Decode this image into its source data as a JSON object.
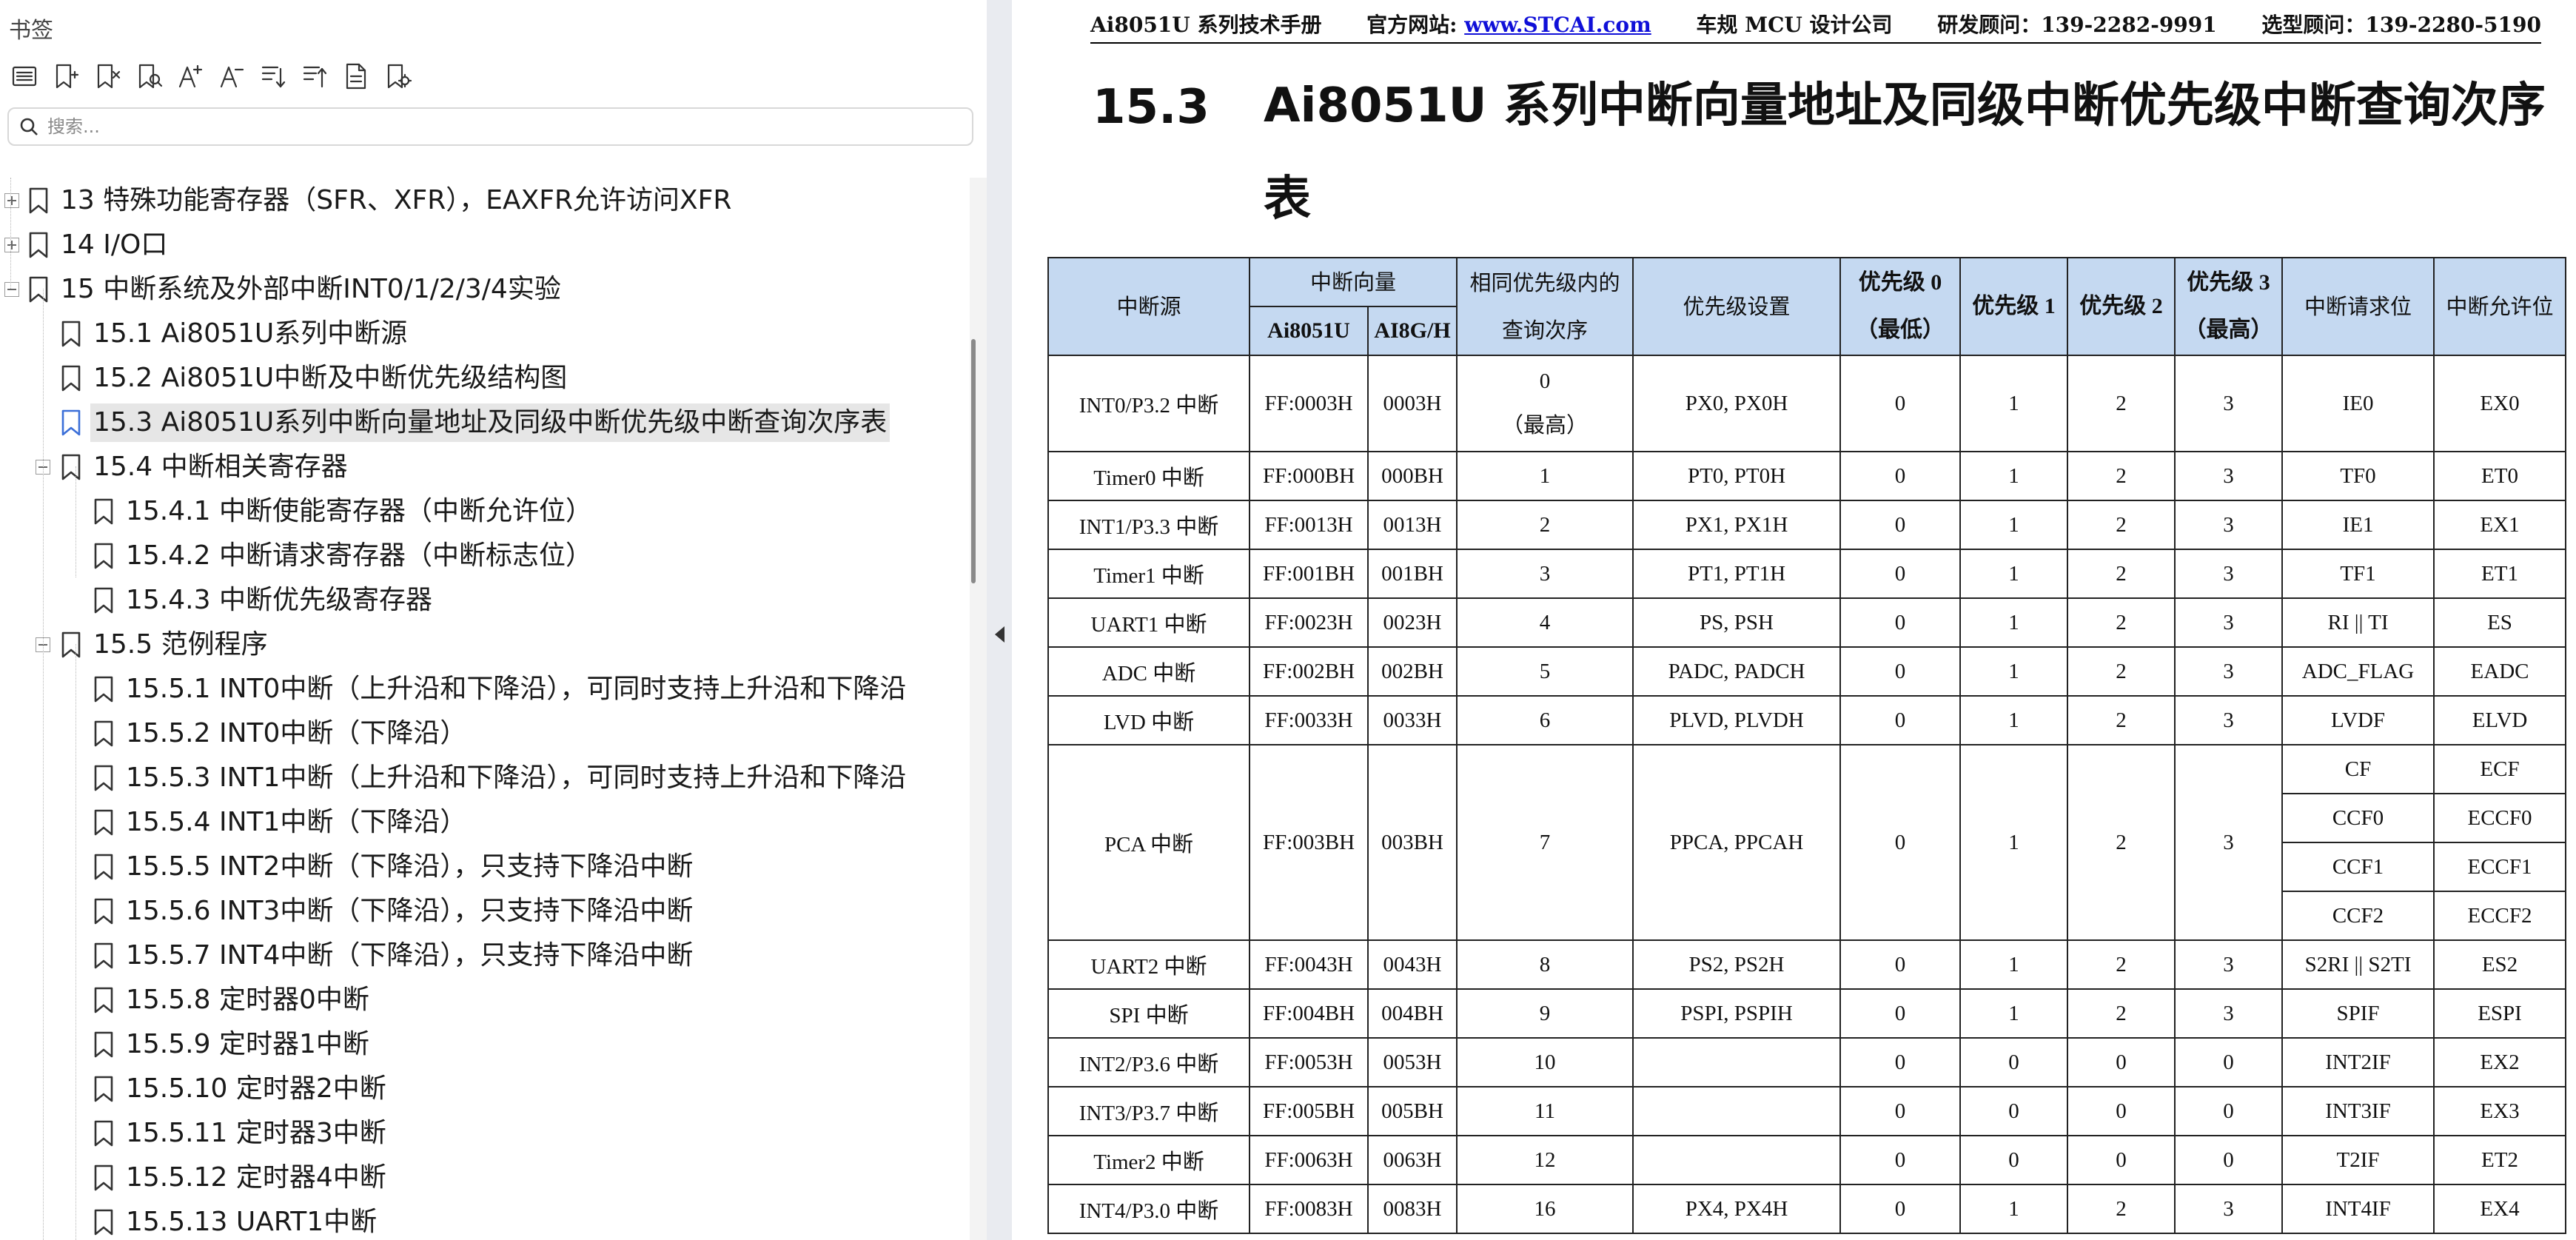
{
  "sidebar": {
    "title": "书签",
    "search_placeholder": "搜索...",
    "toolbar_icons": [
      "list-icon",
      "add-bookmark-icon",
      "delete-bookmark-icon",
      "find-bookmark-icon",
      "expand-text-icon",
      "shrink-text-icon",
      "expand-all-icon",
      "collapse-all-icon",
      "bookmark-properties-icon",
      "bookmark-settings-icon"
    ],
    "items": [
      {
        "label": "13  特殊功能寄存器（SFR、XFR），EAXFR允许访问XFR",
        "level": 0,
        "expander": "plus"
      },
      {
        "label": "14  I/O口",
        "level": 0,
        "expander": "plus"
      },
      {
        "label": "15  中断系统及外部中断INT0/1/2/3/4实验",
        "level": 0,
        "expander": "minus"
      },
      {
        "label": "15.1  Ai8051U系列中断源",
        "level": 1
      },
      {
        "label": "15.2  Ai8051U中断及中断优先级结构图",
        "level": 1
      },
      {
        "label": "15.3  Ai8051U系列中断向量地址及同级中断优先级中断查询次序表",
        "level": 1,
        "selected": true
      },
      {
        "label": "15.4  中断相关寄存器",
        "level": 1,
        "expander": "minus"
      },
      {
        "label": "15.4.1 中断使能寄存器（中断允许位）",
        "level": 2
      },
      {
        "label": "15.4.2  中断请求寄存器（中断标志位）",
        "level": 2
      },
      {
        "label": "15.4.3  中断优先级寄存器",
        "level": 2
      },
      {
        "label": "15.5  范例程序",
        "level": 1,
        "expander": "minus"
      },
      {
        "label": "15.5.1 INT0中断（上升沿和下降沿），可同时支持上升沿和下降沿",
        "level": 2
      },
      {
        "label": "15.5.2 INT0中断（下降沿）",
        "level": 2
      },
      {
        "label": "15.5.3 INT1中断（上升沿和下降沿），可同时支持上升沿和下降沿",
        "level": 2
      },
      {
        "label": "15.5.4 INT1中断（下降沿）",
        "level": 2
      },
      {
        "label": "15.5.5 INT2中断（下降沿），只支持下降沿中断",
        "level": 2
      },
      {
        "label": "15.5.6 INT3中断（下降沿），只支持下降沿中断",
        "level": 2
      },
      {
        "label": "15.5.7 INT4中断（下降沿），只支持下降沿中断",
        "level": 2
      },
      {
        "label": "15.5.8 定时器0中断",
        "level": 2
      },
      {
        "label": "15.5.9 定时器1中断",
        "level": 2
      },
      {
        "label": "15.5.10 定时器2中断",
        "level": 2
      },
      {
        "label": "15.5.11 定时器3中断",
        "level": 2
      },
      {
        "label": "15.5.12 定时器4中断",
        "level": 2
      },
      {
        "label": "15.5.13 UART1中断",
        "level": 2
      }
    ]
  },
  "doc": {
    "header": {
      "manual": "Ai8051U 系列技术手册",
      "website_label": "官方网站: ",
      "website_link": "www.STCAI.com",
      "company": "车规 MCU 设计公司",
      "rd_advisor": "研发顾问：139-2282-9991",
      "selection_advisor": "选型顾问：139-2280-5190"
    },
    "section_number": "15.3",
    "section_title": "Ai8051U  系列中断向量地址及同级中断优先级中断查询次序表",
    "table": {
      "headers": {
        "source": "中断源",
        "vector": "中断向量",
        "vec_a": "Ai8051U",
        "vec_b": "AI8G/H",
        "order": [
          "相同优先级内的",
          "查询次序"
        ],
        "priority_setting": "优先级设置",
        "p0": [
          "优先级 0",
          "（最低）"
        ],
        "p1": "优先级 1",
        "p2": "优先级 2",
        "p3": [
          "优先级 3",
          "（最高）"
        ],
        "request_bit": "中断请求位",
        "enable_bit": "中断允许位"
      },
      "rows": [
        {
          "source": "INT0/P3.2 中断",
          "vec_a": "FF:0003H",
          "vec_b": "0003H",
          "order": [
            "0",
            "（最高）"
          ],
          "priority": "PX0, PX0H",
          "p0": "0",
          "p1": "1",
          "p2": "2",
          "p3": "3",
          "req": [
            "IE0"
          ],
          "en": [
            "EX0"
          ]
        },
        {
          "source": "Timer0 中断",
          "vec_a": "FF:000BH",
          "vec_b": "000BH",
          "order": [
            "1"
          ],
          "priority": "PT0, PT0H",
          "p0": "0",
          "p1": "1",
          "p2": "2",
          "p3": "3",
          "req": [
            "TF0"
          ],
          "en": [
            "ET0"
          ]
        },
        {
          "source": "INT1/P3.3 中断",
          "vec_a": "FF:0013H",
          "vec_b": "0013H",
          "order": [
            "2"
          ],
          "priority": "PX1, PX1H",
          "p0": "0",
          "p1": "1",
          "p2": "2",
          "p3": "3",
          "req": [
            "IE1"
          ],
          "en": [
            "EX1"
          ]
        },
        {
          "source": "Timer1 中断",
          "vec_a": "FF:001BH",
          "vec_b": "001BH",
          "order": [
            "3"
          ],
          "priority": "PT1, PT1H",
          "p0": "0",
          "p1": "1",
          "p2": "2",
          "p3": "3",
          "req": [
            "TF1"
          ],
          "en": [
            "ET1"
          ]
        },
        {
          "source": "UART1 中断",
          "vec_a": "FF:0023H",
          "vec_b": "0023H",
          "order": [
            "4"
          ],
          "priority": "PS, PSH",
          "p0": "0",
          "p1": "1",
          "p2": "2",
          "p3": "3",
          "req": [
            "RI || TI"
          ],
          "en": [
            "ES"
          ]
        },
        {
          "source": "ADC 中断",
          "vec_a": "FF:002BH",
          "vec_b": "002BH",
          "order": [
            "5"
          ],
          "priority": "PADC, PADCH",
          "p0": "0",
          "p1": "1",
          "p2": "2",
          "p3": "3",
          "req": [
            "ADC_FLAG"
          ],
          "en": [
            "EADC"
          ]
        },
        {
          "source": "LVD 中断",
          "vec_a": "FF:0033H",
          "vec_b": "0033H",
          "order": [
            "6"
          ],
          "priority": "PLVD, PLVDH",
          "p0": "0",
          "p1": "1",
          "p2": "2",
          "p3": "3",
          "req": [
            "LVDF"
          ],
          "en": [
            "ELVD"
          ]
        },
        {
          "source": "PCA 中断",
          "vec_a": "FF:003BH",
          "vec_b": "003BH",
          "order": [
            "7"
          ],
          "priority": "PPCA, PPCAH",
          "p0": "0",
          "p1": "1",
          "p2": "2",
          "p3": "3",
          "req": [
            "CF",
            "CCF0",
            "CCF1",
            "CCF2"
          ],
          "en": [
            "ECF",
            "ECCF0",
            "ECCF1",
            "ECCF2"
          ]
        },
        {
          "source": "UART2 中断",
          "vec_a": "FF:0043H",
          "vec_b": "0043H",
          "order": [
            "8"
          ],
          "priority": "PS2, PS2H",
          "p0": "0",
          "p1": "1",
          "p2": "2",
          "p3": "3",
          "req": [
            "S2RI || S2TI"
          ],
          "en": [
            "ES2"
          ]
        },
        {
          "source": "SPI 中断",
          "vec_a": "FF:004BH",
          "vec_b": "004BH",
          "order": [
            "9"
          ],
          "priority": "PSPI, PSPIH",
          "p0": "0",
          "p1": "1",
          "p2": "2",
          "p3": "3",
          "req": [
            "SPIF"
          ],
          "en": [
            "ESPI"
          ]
        },
        {
          "source": "INT2/P3.6 中断",
          "vec_a": "FF:0053H",
          "vec_b": "0053H",
          "order": [
            "10"
          ],
          "priority": "",
          "p0": "0",
          "p1": "0",
          "p2": "0",
          "p3": "0",
          "req": [
            "INT2IF"
          ],
          "en": [
            "EX2"
          ]
        },
        {
          "source": "INT3/P3.7 中断",
          "vec_a": "FF:005BH",
          "vec_b": "005BH",
          "order": [
            "11"
          ],
          "priority": "",
          "p0": "0",
          "p1": "0",
          "p2": "0",
          "p3": "0",
          "req": [
            "INT3IF"
          ],
          "en": [
            "EX3"
          ]
        },
        {
          "source": "Timer2 中断",
          "vec_a": "FF:0063H",
          "vec_b": "0063H",
          "order": [
            "12"
          ],
          "priority": "",
          "p0": "0",
          "p1": "0",
          "p2": "0",
          "p3": "0",
          "req": [
            "T2IF"
          ],
          "en": [
            "ET2"
          ]
        },
        {
          "source": "INT4/P3.0 中断",
          "vec_a": "FF:0083H",
          "vec_b": "0083H",
          "order": [
            "16"
          ],
          "priority": "PX4, PX4H",
          "p0": "0",
          "p1": "1",
          "p2": "2",
          "p3": "3",
          "req": [
            "INT4IF"
          ],
          "en": [
            "EX4"
          ]
        }
      ]
    }
  }
}
